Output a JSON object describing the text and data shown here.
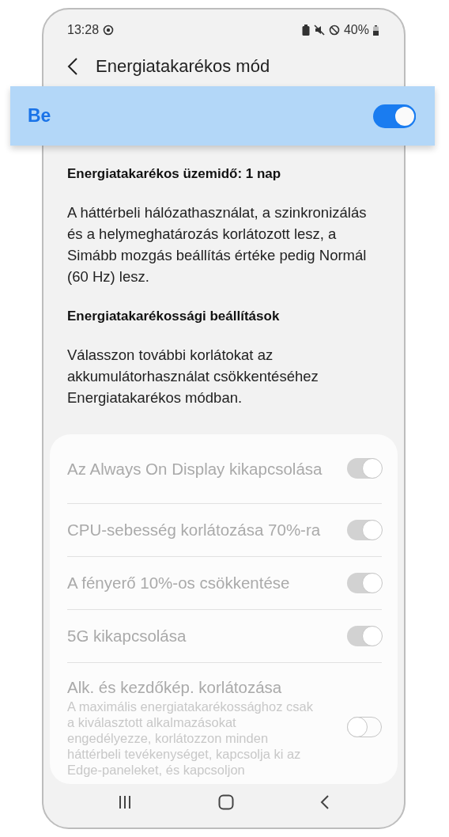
{
  "status_bar": {
    "time": "13:28",
    "battery": "40%"
  },
  "header": {
    "title": "Energiatakarékos mód"
  },
  "master_switch": {
    "label": "Be",
    "on": true
  },
  "info": {
    "runtime": "Energiatakarékos üzemidő: 1 nap",
    "description": "A háttérbeli hálózathasználat, a szinkronizálás és a helymeghatározás korlátozott lesz, a Simább mozgás beállítás értéke pedig Normál (60 Hz) lesz.",
    "settings_heading": "Energiatakarékossági beállítások",
    "settings_description": "Válasszon további korlátokat az akkumulátorhasználat csökkentéséhez Energiatakarékos módban."
  },
  "options": [
    {
      "label": "Az Always On Display kikapcsolása",
      "on": true,
      "disabled": true
    },
    {
      "label": "CPU-sebesség korlátozása 70%-ra",
      "on": true,
      "disabled": true
    },
    {
      "label": "A fényerő 10%-os csökkentése",
      "on": true,
      "disabled": true
    },
    {
      "label": "5G kikapcsolása",
      "on": true,
      "disabled": true
    },
    {
      "label": "Alk. és kezdőkép. korlátozása",
      "description": "A maximális energiatakarékossághoz csak a kiválasztott alkalmazásokat engedélyezze, korlátozzon minden háttérbeli tevékenységet, kapcsolja ki az Edge-paneleket, és kapcsoljon",
      "on": false,
      "disabled": true
    }
  ]
}
